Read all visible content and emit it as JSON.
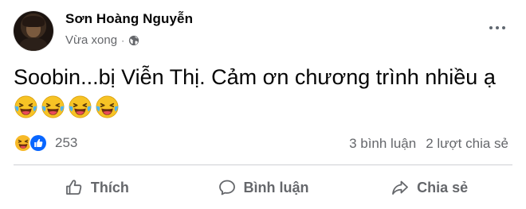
{
  "post": {
    "author_name": "Sơn Hoàng Nguyễn",
    "timestamp": "Vừa xong",
    "separator": "·",
    "privacy_icon": "globe-icon",
    "more_icon": "more-horizontal-icon",
    "text_main": "Soobin...bị Viễn Thị. Cảm ơn chương trình nhiều ạ",
    "emoji_icons": [
      "laughing-tears-emoji",
      "laughing-tears-emoji",
      "laughing-tears-emoji",
      "laughing-tears-emoji"
    ]
  },
  "reactions": {
    "icons": [
      "haha-reaction-icon",
      "like-reaction-icon"
    ],
    "count": "253",
    "comments": "3 bình luận",
    "shares": "2 lượt chia sẻ"
  },
  "actions": [
    {
      "label": "Thích",
      "icon": "thumbs-up-icon"
    },
    {
      "label": "Bình luận",
      "icon": "comment-bubble-icon"
    },
    {
      "label": "Chia sẻ",
      "icon": "share-arrow-icon"
    }
  ],
  "colors": {
    "text_primary": "#050505",
    "text_secondary": "#65676b",
    "like_blue": "#0866ff",
    "haha_yellow": "#f7b928",
    "divider": "#ced0d4"
  }
}
